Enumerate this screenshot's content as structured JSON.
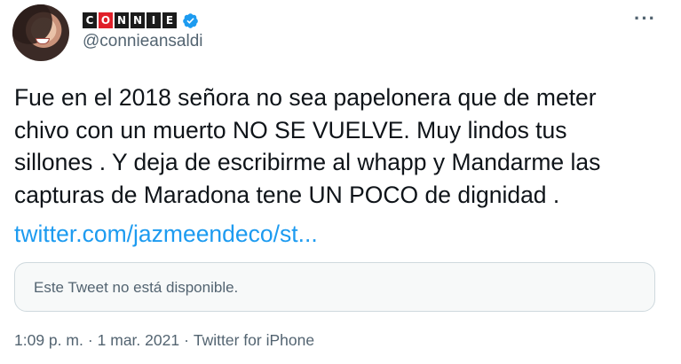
{
  "author": {
    "display_name_letters": [
      "C",
      "O",
      "N",
      "N",
      "I",
      "E"
    ],
    "display_name_colors": [
      "#1b1b1b",
      "#e0202a",
      "#1b1b1b",
      "#1b1b1b",
      "#1b1b1b",
      "#1b1b1b"
    ],
    "handle": "@connieansaldi",
    "verified": true,
    "verified_color": "#1d9bf0"
  },
  "menu": {
    "more_label": "···"
  },
  "tweet": {
    "text": "Fue en el 2018 señora  no sea papelonera que de meter\nchivo con un muerto NO SE VUELVE. Muy lindos tus\nsillones . Y deja de escribirme al whapp y Mandarme las\ncapturas de Maradona tene UN POCO de dignidad .",
    "link_text": "twitter.com/jazmeendeco/st...",
    "link_color": "#1d9bf0",
    "quoted_unavailable": "Este Tweet no está disponible.",
    "time": "1:09 p. m.",
    "date": "1 mar. 2021",
    "source": "Twitter for iPhone",
    "separator": "·"
  }
}
